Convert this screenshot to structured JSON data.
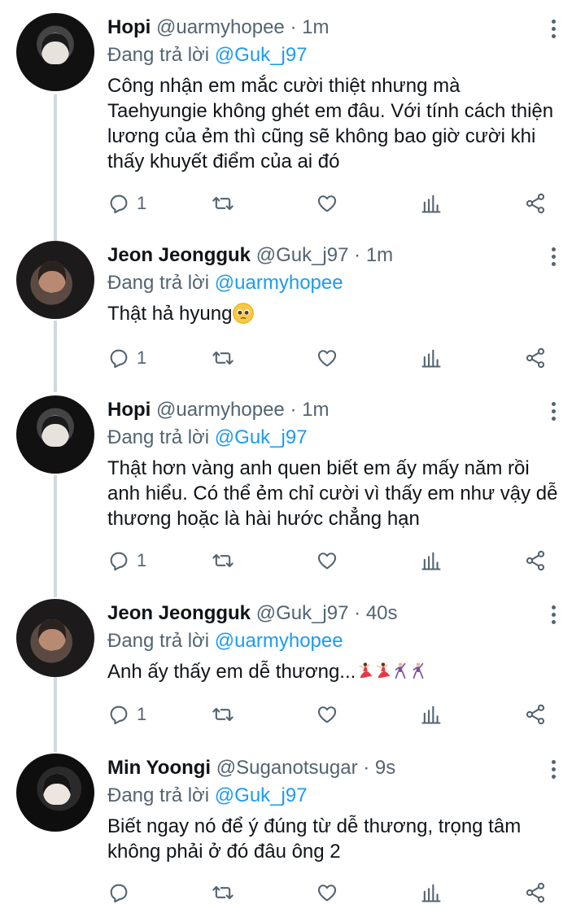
{
  "tweets": [
    {
      "name": "Hopi",
      "handle": "@uarmyhopee",
      "time": "1m",
      "reply_prefix": "Đang trả lời",
      "reply_to": "@Guk_j97",
      "text": "Công nhận em mắc cười thiệt nhưng mà Taehyungie không ghét em đâu. Với tính cách thiện lương của ẻm thì cũng sẽ không bao giờ cười khi thấy khuyết điểm của ai đó",
      "reply_count": "1",
      "avatar": "hopi-avatar"
    },
    {
      "name": "Jeon Jeongguk",
      "handle": "@Guk_j97",
      "time": "1m",
      "reply_prefix": "Đang trả lời",
      "reply_to": "@uarmyhopee",
      "text": "Thật hả hyung",
      "emoji": "pleading-face-emoji",
      "reply_count": "1",
      "avatar": "jeongguk-avatar"
    },
    {
      "name": "Hopi",
      "handle": "@uarmyhopee",
      "time": "1m",
      "reply_prefix": "Đang trả lời",
      "reply_to": "@Guk_j97",
      "text": "Thật hơn vàng anh quen biết em ấy mấy năm rồi anh hiểu. Có thể ẻm chỉ cười vì thấy em như vậy dễ thương hoặc là hài hước chẳng hạn",
      "reply_count": "1",
      "avatar": "hopi-avatar"
    },
    {
      "name": "Jeon Jeongguk",
      "handle": "@Guk_j97",
      "time": "40s",
      "reply_prefix": "Đang trả lời",
      "reply_to": "@uarmyhopee",
      "text": "Anh ấy thấy em dễ thương...",
      "emoji": "dancer-emojis",
      "reply_count": "1",
      "avatar": "jeongguk-avatar"
    },
    {
      "name": "Min Yoongi",
      "handle": "@Suganotsugar",
      "time": "9s",
      "reply_prefix": "Đang trả lời",
      "reply_to": "@Guk_j97",
      "text": "Biết ngay nó để ý đúng từ dễ thương, trọng tâm không phải ở đó đâu ông 2",
      "reply_count": "",
      "avatar": "yoongi-avatar"
    }
  ],
  "separator": "·",
  "icons": [
    "reply-icon",
    "retweet-icon",
    "like-icon",
    "analytics-icon",
    "share-icon",
    "more-options-icon"
  ],
  "colors": {
    "link": "#1d9bf0",
    "secondary": "#536471",
    "thread_line": "#cfd9de"
  }
}
